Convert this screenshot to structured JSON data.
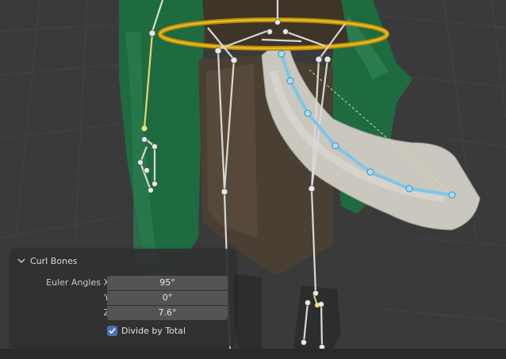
{
  "redo_panel": {
    "title": "Curl Bones",
    "euler_label": "Euler Angles X",
    "y_label": "Y",
    "z_label": "Z",
    "x_value": "95°",
    "y_value": "0°",
    "z_value": "7.6°",
    "divide_label": "Divide by Total",
    "divide_checked": true
  },
  "colors": {
    "viewport_bg": "#3a3a3a",
    "selected_bone": "#7cc6ea",
    "active_bone_yellow": "#e8d66a",
    "ring": "#d4a514",
    "checkbox_accent": "#4772b3"
  }
}
